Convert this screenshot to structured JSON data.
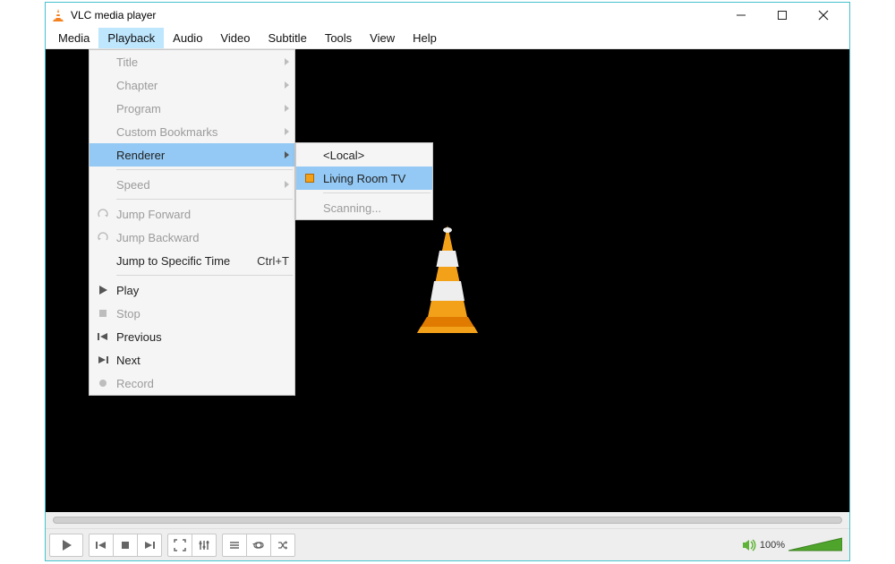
{
  "window": {
    "title": "VLC media player"
  },
  "menubar": {
    "media": "Media",
    "playback": "Playback",
    "audio": "Audio",
    "video": "Video",
    "subtitle": "Subtitle",
    "tools": "Tools",
    "view": "View",
    "help": "Help"
  },
  "playback_menu": {
    "title": "Title",
    "chapter": "Chapter",
    "program": "Program",
    "custom_bookmarks": "Custom Bookmarks",
    "renderer": "Renderer",
    "speed": "Speed",
    "jump_forward": "Jump Forward",
    "jump_backward": "Jump Backward",
    "jump_specific": "Jump to Specific Time",
    "jump_specific_shortcut": "Ctrl+T",
    "play": "Play",
    "stop": "Stop",
    "previous": "Previous",
    "next": "Next",
    "record": "Record"
  },
  "renderer_menu": {
    "local": "<Local>",
    "living_room": "Living Room TV",
    "scanning": "Scanning..."
  },
  "volume_pct": "100%"
}
